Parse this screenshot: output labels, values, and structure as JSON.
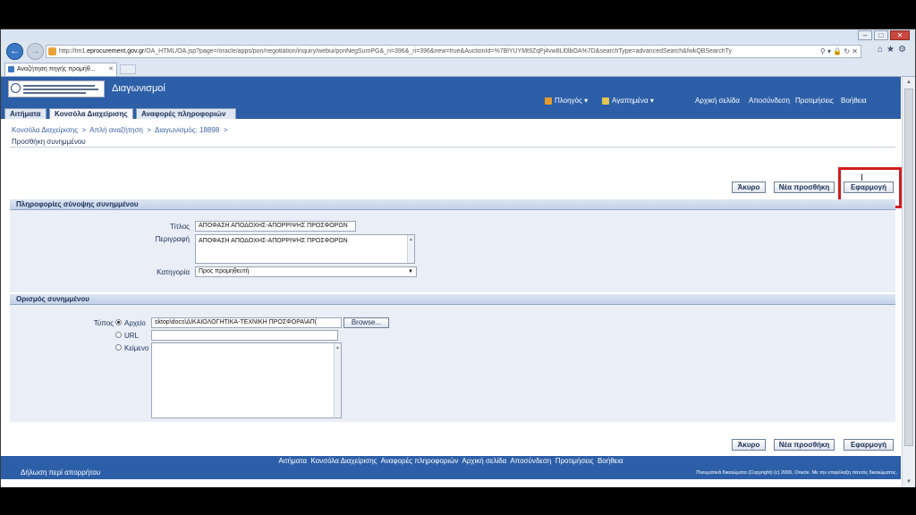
{
  "browser": {
    "url_prefix": "http://tm1.",
    "url_domain": "eprocurement.gov.gr",
    "url_rest": "/OA_HTML/OA.jsp?page=/oracle/apps/pon/negotiation/inquiry/webui/ponNegSumPG&_ri=396&_ri=396&new=true&AuctionId=%7BlYUYMt9ZqPj4vw8Ll0lbOA%7D&searchType=advancedSearch&fwkQBSearchTy",
    "addr_icons": "⚲ ▾ 🔒 ↻ ✕",
    "tab_title": "Αναζήτηση πηγής προμήθ...",
    "tab_close": "✕",
    "right_tools": "⌂★⚙"
  },
  "header": {
    "app_title": "Διαγωνισμοί",
    "nav_menu": "Πλοηγός",
    "favorites_menu": "Αγαπημένα",
    "global_links": [
      "Αρχική σελίδα",
      "Αποσύνδεση",
      "Προτιμήσεις",
      "Βοήθεια"
    ]
  },
  "tabs": [
    "Αιτήματα",
    "Κονσόλα Διαχείρισης",
    "Αναφορές πληροφοριών"
  ],
  "breadcrumb": {
    "items": [
      "Κονσόλα Διαχείρισης",
      "Απλή αναζήτηση",
      "Διαγωνισμός: 18898"
    ],
    "sep": ">"
  },
  "page_title": "Προσθήκη συνημμένου",
  "buttons": {
    "cancel": "Άκυρο",
    "add_another": "Νέα προσθήκη",
    "apply": "Εφαρμογή"
  },
  "summary_section": {
    "title": "Πληροφορίες σύνοψης συνημμένου",
    "title_label": "Τίτλος",
    "title_value": "ΑΠΟΦΑΣΗ ΑΠΟΔΟΧΗΣ-ΑΠΟΡΡΙΨΗΣ ΠΡΟΣΦΟΡΩΝ",
    "description_label": "Περιγραφή",
    "description_value": "ΑΠΟΦΑΣΗ ΑΠΟΔΟΧΗΣ-ΑΠΟΡΡΙΨΗΣ ΠΡΟΣΦΟΡΩΝ",
    "category_label": "Κατηγορία",
    "category_value": "Προς προμηθευτή"
  },
  "definition_section": {
    "title": "Ορισμός συνημμένου",
    "type_label": "Τύπος",
    "option_file": "Αρχείο",
    "option_url": "URL",
    "option_text": "Κείμενο",
    "file_value": "sktop\\docs\\ΔΙΚΑΙΟΛΟΓΗΤΙΚΑ-ΤΕΧΝΙΚΗ ΠΡΟΣΦΟΡΑ\\ΑΠ(",
    "browse_label": "Browse...",
    "url_value": "",
    "text_value": "",
    "selected": "file"
  },
  "footer": {
    "links": [
      "Αιτήματα",
      "Κονσόλα Διαχείρισης",
      "Αναφορές πληροφοριών",
      "Αρχική σελίδα",
      "Αποσύνδεση",
      "Προτιμήσεις",
      "Βοήθεια"
    ],
    "privacy": "Δήλωση περί απορρήτου",
    "copyright": "Πνευματικά δικαιώματα (Copyright) (c) 2006, Oracle. Με την επιφύλαξη παντός δικαιώματος."
  },
  "colors": {
    "header_blue": "#2d5fa8",
    "highlight_red": "#d21c1c",
    "section_bg": "#eaeef6"
  }
}
